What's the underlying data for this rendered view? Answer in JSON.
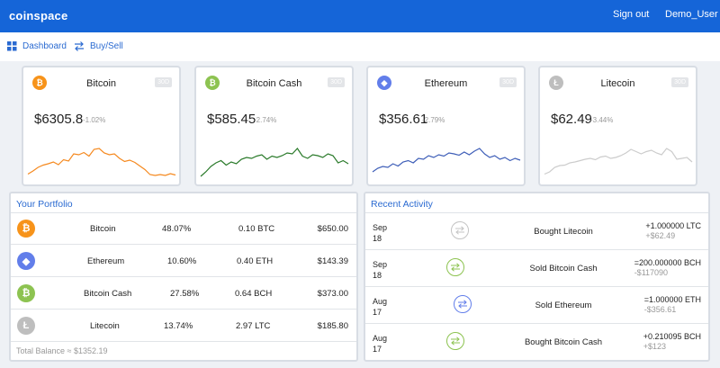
{
  "header": {
    "brand": "coinspace",
    "sign_out": "Sign out",
    "user": "Demo_User"
  },
  "nav": [
    {
      "label": "Dashboard",
      "icon": "dashboard-grid-icon"
    },
    {
      "label": "Buy/Sell",
      "icon": "swap-arrows-icon"
    }
  ],
  "coins": [
    {
      "name": "Bitcoin",
      "price": "$6305.8",
      "change": "-1.02%",
      "badge": "30D",
      "color": "#f7931a",
      "line_color": "#f5891f",
      "symbol": "₿",
      "icon": "bitcoin-icon",
      "trend": [
        0.15,
        0.22,
        0.3,
        0.35,
        0.38,
        0.42,
        0.36,
        0.47,
        0.44,
        0.6,
        0.58,
        0.63,
        0.55,
        0.7,
        0.72,
        0.62,
        0.58,
        0.6,
        0.5,
        0.43,
        0.46,
        0.41,
        0.33,
        0.25,
        0.14,
        0.12,
        0.14,
        0.12,
        0.16,
        0.13
      ]
    },
    {
      "name": "Bitcoin Cash",
      "price": "$585.45",
      "change": "-2.74%",
      "badge": "30D",
      "color": "#8dc351",
      "line_color": "#2a7a2a",
      "symbol": "₿",
      "icon": "bitcoin-cash-icon",
      "trend": [
        0.1,
        0.2,
        0.32,
        0.4,
        0.45,
        0.35,
        0.42,
        0.38,
        0.48,
        0.52,
        0.5,
        0.55,
        0.58,
        0.48,
        0.55,
        0.52,
        0.56,
        0.62,
        0.6,
        0.72,
        0.55,
        0.5,
        0.58,
        0.56,
        0.52,
        0.6,
        0.56,
        0.4,
        0.45,
        0.38
      ]
    },
    {
      "name": "Ethereum",
      "price": "$356.61",
      "change": "-2.79%",
      "badge": "30D",
      "color": "#627eea",
      "line_color": "#3f5fb8",
      "symbol": "◆",
      "icon": "ethereum-icon",
      "trend": [
        0.2,
        0.28,
        0.32,
        0.3,
        0.38,
        0.33,
        0.42,
        0.45,
        0.4,
        0.5,
        0.48,
        0.56,
        0.52,
        0.58,
        0.55,
        0.62,
        0.6,
        0.57,
        0.64,
        0.58,
        0.66,
        0.72,
        0.6,
        0.52,
        0.56,
        0.48,
        0.52,
        0.45,
        0.5,
        0.46
      ]
    },
    {
      "name": "Litecoin",
      "price": "$62.49",
      "change": "-3.44%",
      "badge": "30D",
      "color": "#bebebe",
      "line_color": "#cccccc",
      "symbol": "Ł",
      "icon": "litecoin-icon",
      "trend": [
        0.15,
        0.2,
        0.3,
        0.34,
        0.35,
        0.4,
        0.42,
        0.45,
        0.48,
        0.5,
        0.47,
        0.53,
        0.55,
        0.5,
        0.52,
        0.56,
        0.62,
        0.7,
        0.65,
        0.6,
        0.65,
        0.68,
        0.62,
        0.58,
        0.72,
        0.65,
        0.48,
        0.5,
        0.52,
        0.42
      ]
    }
  ],
  "portfolio": {
    "title": "Your Portfolio",
    "rows": [
      {
        "name": "Bitcoin",
        "pct": "48.07%",
        "amount": "0.10 BTC",
        "value": "$650.00",
        "color": "#f7931a",
        "symbol": "₿",
        "icon": "bitcoin-icon"
      },
      {
        "name": "Ethereum",
        "pct": "10.60%",
        "amount": "0.40 ETH",
        "value": "$143.39",
        "color": "#627eea",
        "symbol": "◆",
        "icon": "ethereum-icon"
      },
      {
        "name": "Bitcoin Cash",
        "pct": "27.58%",
        "amount": "0.64 BCH",
        "value": "$373.00",
        "color": "#8dc351",
        "symbol": "₿",
        "icon": "bitcoin-cash-icon"
      },
      {
        "name": "Litecoin",
        "pct": "13.74%",
        "amount": "2.97 LTC",
        "value": "$185.80",
        "color": "#bebebe",
        "symbol": "Ł",
        "icon": "litecoin-icon"
      }
    ],
    "total": "Total Balance ≈ $1352.19"
  },
  "activity": {
    "title": "Recent Activity",
    "rows": [
      {
        "month": "Sep",
        "day": "18",
        "desc": "Bought Litecoin",
        "amount": "+1.000000 LTC",
        "fiat": "+$62.49",
        "color": "#c4c4c4",
        "icon": "swap-icon"
      },
      {
        "month": "Sep",
        "day": "18",
        "desc": "Sold Bitcoin Cash",
        "amount": "=200.000000 BCH",
        "fiat": "-$117090",
        "color": "#8dc351",
        "icon": "swap-icon"
      },
      {
        "month": "Aug",
        "day": "17",
        "desc": "Sold Ethereum",
        "amount": "=1.000000 ETH",
        "fiat": "-$356.61",
        "color": "#627eea",
        "icon": "swap-icon"
      },
      {
        "month": "Aug",
        "day": "17",
        "desc": "Bought Bitcoin Cash",
        "amount": "+0.210095 BCH",
        "fiat": "+$123",
        "color": "#8dc351",
        "icon": "swap-icon"
      }
    ]
  }
}
